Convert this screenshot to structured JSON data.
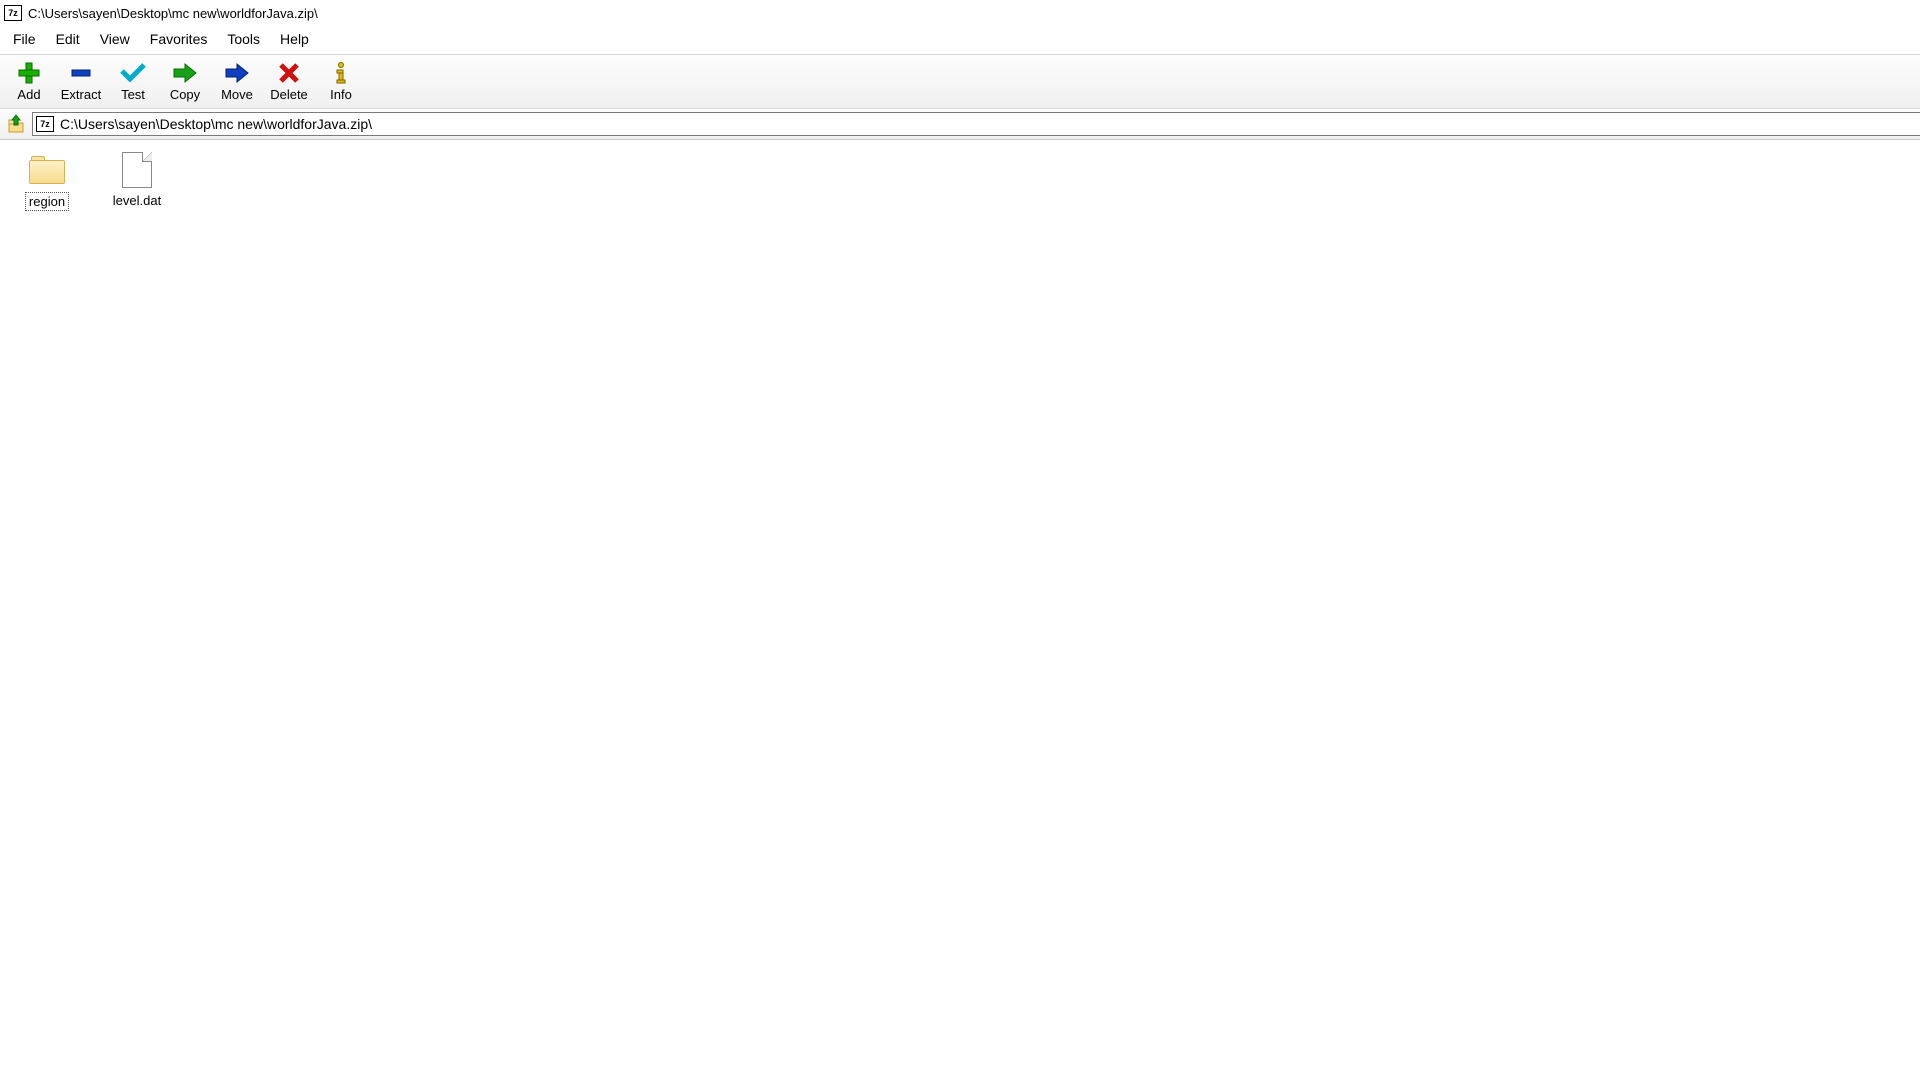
{
  "window": {
    "title": "C:\\Users\\sayen\\Desktop\\mc new\\worldforJava.zip\\",
    "app_icon_text": "7z"
  },
  "menu": {
    "items": [
      "File",
      "Edit",
      "View",
      "Favorites",
      "Tools",
      "Help"
    ]
  },
  "toolbar": {
    "buttons": [
      {
        "id": "add",
        "label": "Add",
        "icon": "plus"
      },
      {
        "id": "extract",
        "label": "Extract",
        "icon": "minus"
      },
      {
        "id": "test",
        "label": "Test",
        "icon": "check"
      },
      {
        "id": "copy",
        "label": "Copy",
        "icon": "arrow-right-green"
      },
      {
        "id": "move",
        "label": "Move",
        "icon": "arrow-right-blue"
      },
      {
        "id": "delete",
        "label": "Delete",
        "icon": "x-red"
      },
      {
        "id": "info",
        "label": "Info",
        "icon": "info"
      }
    ]
  },
  "address": {
    "icon_text": "7z",
    "path": "C:\\Users\\sayen\\Desktop\\mc new\\worldforJava.zip\\"
  },
  "files": [
    {
      "name": "region",
      "type": "folder",
      "selected": true
    },
    {
      "name": "level.dat",
      "type": "file",
      "selected": false
    }
  ]
}
